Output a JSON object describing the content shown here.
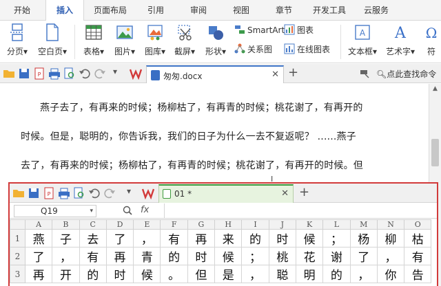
{
  "ribbon_tabs": [
    "开始",
    "插入",
    "页面布局",
    "引用",
    "审阅",
    "视图",
    "章节",
    "开发工具",
    "云服务"
  ],
  "active_tab": "插入",
  "ribbon": {
    "page_break": "分页",
    "blank_page": "空白页",
    "table": "表格",
    "picture": "图片",
    "gallery": "图库",
    "screenshot": "截屏",
    "shapes": "形状",
    "smartart": "SmartArt",
    "chart": "图表",
    "relation_chart": "关系图",
    "online_chart": "在线图表",
    "textbox": "文本框",
    "wordart": "艺术字",
    "symbol": "符"
  },
  "doc_toolbar": {
    "doc_tab_title": "匆匆.docx",
    "search_commands": "点此查找命令"
  },
  "document": {
    "lines": [
      "燕子去了，有再来的时候；杨柳枯了，有再青的时候；桃花谢了，有再开的",
      "时候。但是，聪明的，你告诉我，我们的日子为什么一去不复返呢？ ......燕子",
      "去了，有再来的时候；杨柳枯了，有再青的时候；桃花谢了，有再开的时候。但"
    ]
  },
  "sheet": {
    "tab_title": "01 *",
    "name_box": "Q19",
    "fx_label": "fx",
    "columns": [
      "A",
      "B",
      "C",
      "D",
      "E",
      "F",
      "G",
      "H",
      "I",
      "J",
      "K",
      "L",
      "M",
      "N",
      "O"
    ],
    "rows": [
      {
        "num": "1",
        "cells": [
          "燕",
          "子",
          "去",
          "了",
          "，",
          "有",
          "再",
          "来",
          "的",
          "时",
          "候",
          "；",
          "杨",
          "柳",
          "枯"
        ]
      },
      {
        "num": "2",
        "cells": [
          "了",
          "，",
          "有",
          "再",
          "青",
          "的",
          "时",
          "候",
          "；",
          "桃",
          "花",
          "谢",
          "了",
          "，",
          "有"
        ]
      },
      {
        "num": "3",
        "cells": [
          "再",
          "开",
          "的",
          "时",
          "候",
          "。",
          "但",
          "是",
          "，",
          "聪",
          "明",
          "的",
          "，",
          "你",
          "告"
        ]
      }
    ]
  }
}
